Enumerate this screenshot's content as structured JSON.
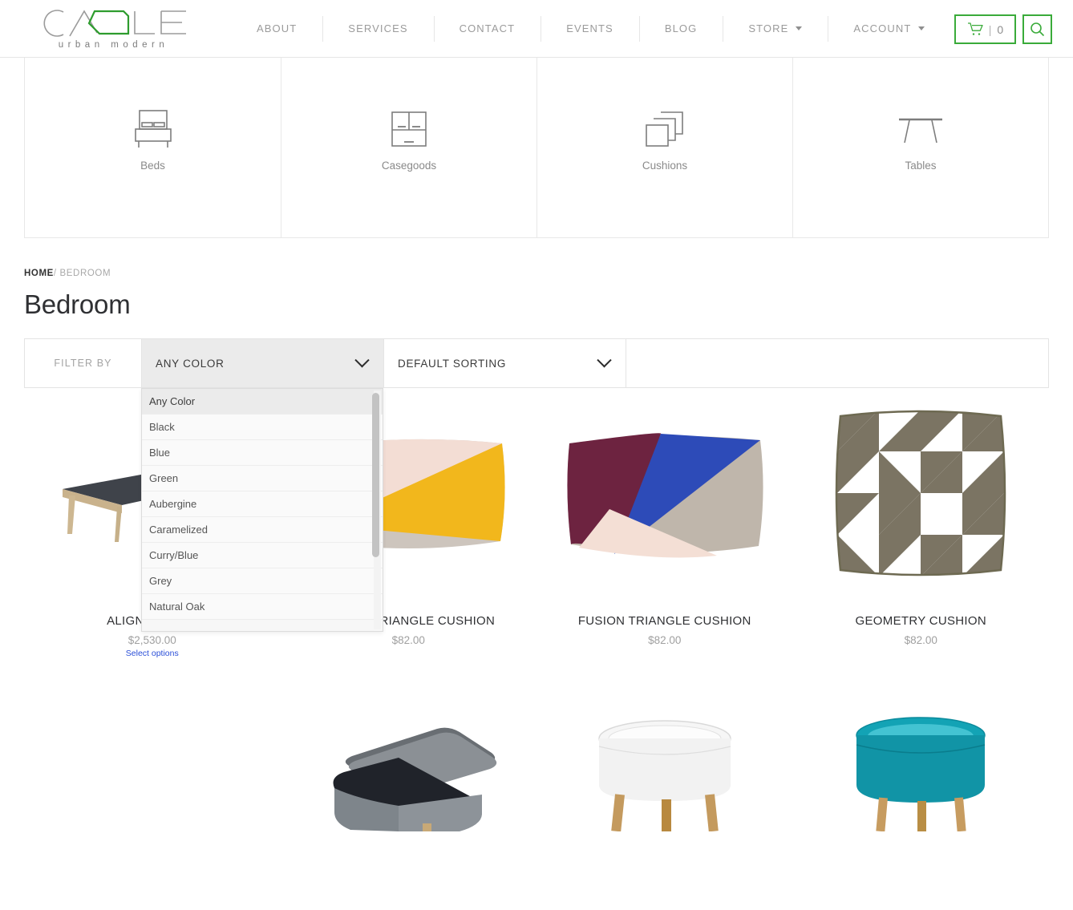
{
  "brand": {
    "name": "CASLE",
    "tagline": "urban modern",
    "accent": "#3aab3a"
  },
  "nav": {
    "items": [
      {
        "label": "ABOUT",
        "has_caret": false
      },
      {
        "label": "SERVICES",
        "has_caret": false
      },
      {
        "label": "CONTACT",
        "has_caret": false
      },
      {
        "label": "EVENTS",
        "has_caret": false
      },
      {
        "label": "BLOG",
        "has_caret": false
      },
      {
        "label": "STORE",
        "has_caret": true
      },
      {
        "label": "ACCOUNT",
        "has_caret": true
      }
    ]
  },
  "header_actions": {
    "cart_icon": "shopping-cart-icon",
    "cart_separator": "|",
    "cart_count": "0",
    "search_icon": "search-icon"
  },
  "categories": [
    {
      "label": "Beds",
      "icon": "bed-icon"
    },
    {
      "label": "Casegoods",
      "icon": "cabinet-icon"
    },
    {
      "label": "Cushions",
      "icon": "stacked-squares-icon"
    },
    {
      "label": "Tables",
      "icon": "table-icon"
    }
  ],
  "breadcrumb": {
    "home": "HOME",
    "separator": "/",
    "current": "BEDROOM"
  },
  "page": {
    "title": "Bedroom"
  },
  "filter_bar": {
    "label": "FILTER BY",
    "color_select": {
      "value": "ANY COLOR",
      "open": true,
      "options": [
        "Any Color",
        "Black",
        "Blue",
        "Green",
        "Aubergine",
        "Caramelized",
        "Curry/Blue",
        "Grey",
        "Natural Oak"
      ],
      "selected": "Any Color"
    },
    "sort_select": {
      "value": "DEFAULT SORTING"
    }
  },
  "products": {
    "row1": [
      {
        "title": "ALIGN DAYBED",
        "price": "$2,530.00",
        "action": "Select options",
        "image": "daybed-photo"
      },
      {
        "title": "FUSION TRIANGLE CUSHION",
        "price": "$82.00",
        "action": "",
        "image": "cushion-yellow-photo"
      },
      {
        "title": "FUSION TRIANGLE CUSHION",
        "price": "$82.00",
        "action": "",
        "image": "cushion-blue-photo"
      },
      {
        "title": "GEOMETRY CUSHION",
        "price": "$82.00",
        "action": "",
        "image": "cushion-geometry-photo"
      }
    ],
    "row2": [
      {
        "image": ""
      },
      {
        "image": "grey-storage-table-photo"
      },
      {
        "image": "white-round-table-photo"
      },
      {
        "image": "teal-round-table-photo"
      }
    ]
  }
}
